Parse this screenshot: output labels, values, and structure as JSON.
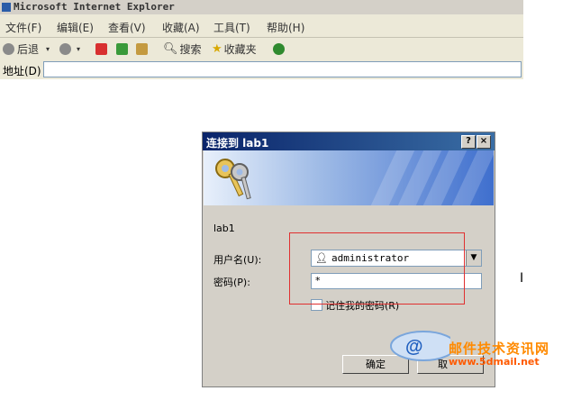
{
  "window": {
    "title": "Microsoft Internet Explorer"
  },
  "menubar": {
    "items": [
      "文件(F)",
      "编辑(E)",
      "查看(V)",
      "收藏(A)",
      "工具(T)",
      "帮助(H)"
    ]
  },
  "toolbar": {
    "back_label": "后退",
    "search_label": "搜索",
    "favorites_label": "收藏夹"
  },
  "addressbar": {
    "label": "地址(D)",
    "value": ""
  },
  "dialog": {
    "title": "连接到 lab1",
    "help_button": "?",
    "close_button": "×",
    "server_label": "lab1",
    "username_label": "用户名(U):",
    "username_value": "administrator",
    "password_label": "密码(P):",
    "password_value": "*",
    "remember_label": "记住我的密码(R)",
    "remember_checked": false,
    "ok_label": "确定",
    "cancel_label": "取"
  },
  "watermark": {
    "chinese": "邮件技术资讯网",
    "url": "www.5dmail.net"
  },
  "colors": {
    "dialog_title_bar": "#0a246a",
    "highlight_box": "#e03030",
    "watermark_orange": "#ff8a00"
  }
}
